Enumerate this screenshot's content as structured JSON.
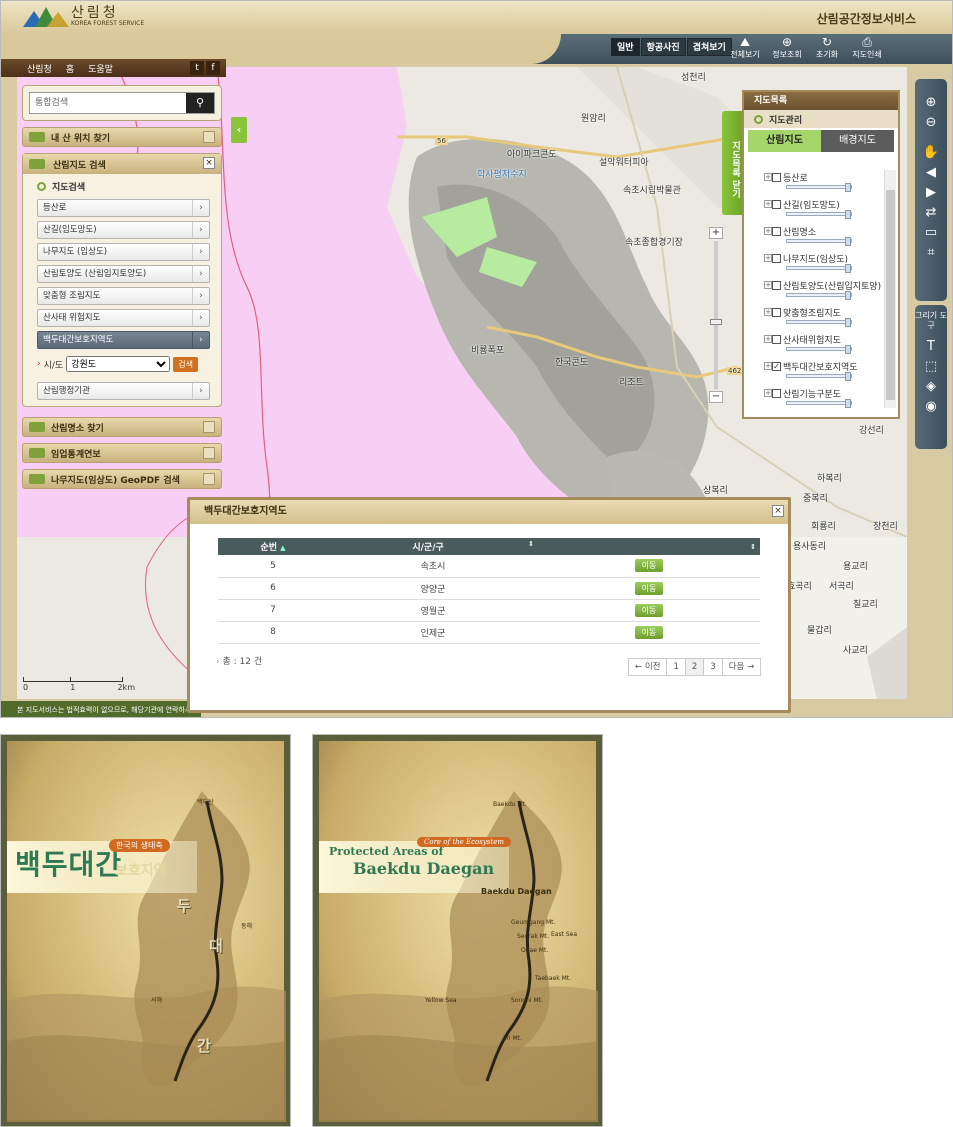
{
  "app": {
    "logo_ko": "산림청",
    "logo_en": "KOREA FOREST SERVICE",
    "service_title": "산림공간정보서비스"
  },
  "maptype": [
    "일반",
    "항공사진",
    "겹쳐보기"
  ],
  "tools": [
    "전체보기",
    "정보조회",
    "초기화",
    "지도인쇄"
  ],
  "nav": {
    "items": [
      "산림청",
      "홈",
      "도움말"
    ],
    "sns": [
      "t",
      "f"
    ]
  },
  "search": {
    "placeholder": "통합검색"
  },
  "accordions": {
    "my_mountain": "내 산 위치 찾기",
    "forest_map": "산림지도 검색",
    "famous": "산림명소 찾기",
    "stats": "임업통계연보",
    "geopdf": "나무지도(임상도) GeoPDF 검색"
  },
  "map_search": {
    "section": "지도검색",
    "layers": [
      "등산로",
      "산길(임도망도)",
      "나무지도 (임상도)",
      "산림토양도 (산림입지토양도)",
      "맞춤형 조림지도",
      "산사태 위험지도",
      "백두대간보호지역도"
    ],
    "selected_index": 6,
    "sido_label": "시/도",
    "sido_value": "강원도",
    "search_btn": "검색",
    "admin": "산림행정기관"
  },
  "layer_panel": {
    "header": "지도목록",
    "sub": "지도관리",
    "tab_forest": "산림지도",
    "tab_base": "배경지도",
    "items": [
      {
        "label": "등산로",
        "checked": false
      },
      {
        "label": "산길(임도망도)",
        "checked": false
      },
      {
        "label": "산림명소",
        "checked": false
      },
      {
        "label": "나무지도(임상도)",
        "checked": false
      },
      {
        "label": "산림토양도(산림입지토양)",
        "checked": false
      },
      {
        "label": "맞춤형조림지도",
        "checked": false
      },
      {
        "label": "산사태위험지도",
        "checked": false
      },
      {
        "label": "백두대간보호지역도",
        "checked": true
      },
      {
        "label": "산림기능구분도",
        "checked": false
      }
    ],
    "close_label": "지도목록 닫기"
  },
  "map_labels": [
    {
      "t": "성천리"
    },
    {
      "t": "원암리"
    },
    {
      "t": "56"
    },
    {
      "t": "아이파크콘도"
    },
    {
      "t": "설악워터피아"
    },
    {
      "t": "학사평저수지"
    },
    {
      "t": "속초시립박물관"
    },
    {
      "t": "속초종합경기장"
    },
    {
      "t": "비룡폭포"
    },
    {
      "t": "한국콘도"
    },
    {
      "t": "리조트"
    },
    {
      "t": "462"
    },
    {
      "t": "강선리"
    },
    {
      "t": "하복리"
    },
    {
      "t": "상복리"
    },
    {
      "t": "중복리"
    },
    {
      "t": "회룡리"
    },
    {
      "t": "장천리"
    },
    {
      "t": "용사동리"
    },
    {
      "t": "용교리"
    },
    {
      "t": "서곡리"
    },
    {
      "t": "칠교리"
    },
    {
      "t": "물갑리"
    },
    {
      "t": "사교리"
    },
    {
      "t": "효곡리"
    }
  ],
  "result": {
    "title": "백두대간보호지역도",
    "columns": [
      "순번",
      "시/군/구",
      ""
    ],
    "rows": [
      {
        "no": "5",
        "name": "속초시",
        "btn": "이동"
      },
      {
        "no": "6",
        "name": "양양군",
        "btn": "이동"
      },
      {
        "no": "7",
        "name": "영월군",
        "btn": "이동"
      },
      {
        "no": "8",
        "name": "인제군",
        "btn": "이동"
      }
    ],
    "total": "총 : 12 건",
    "pager": [
      "← 이전",
      "1",
      "2",
      "3",
      "다음 →"
    ],
    "current_page": "2"
  },
  "scale": [
    "0",
    "1",
    "2km"
  ],
  "notice": "본 지도서비스는 법적효력이 없으므로, 해당기관에 연락하시기 바랍니다.",
  "draw_tools_label": "그리기 도구",
  "poster_ko": {
    "title": "백두대간",
    "tag": "한국의 생태축",
    "sub": "보호지역",
    "big": [
      "두",
      "대",
      "간"
    ],
    "labels": [
      "백두산",
      "동해",
      "서해"
    ]
  },
  "poster_en": {
    "title1": "Protected Areas of",
    "title2": "Baekdu Daegan",
    "tag": "Core of the Ecosystem",
    "labels": [
      "Baekdu Mt.",
      "Baekdu Daegan",
      "Geumgang Mt.",
      "Seorak Mt.",
      "East Sea",
      "Odae Mt.",
      "Taebaek Mt.",
      "Yellow Sea",
      "Songni Mt.",
      "Jiri Mt."
    ]
  }
}
